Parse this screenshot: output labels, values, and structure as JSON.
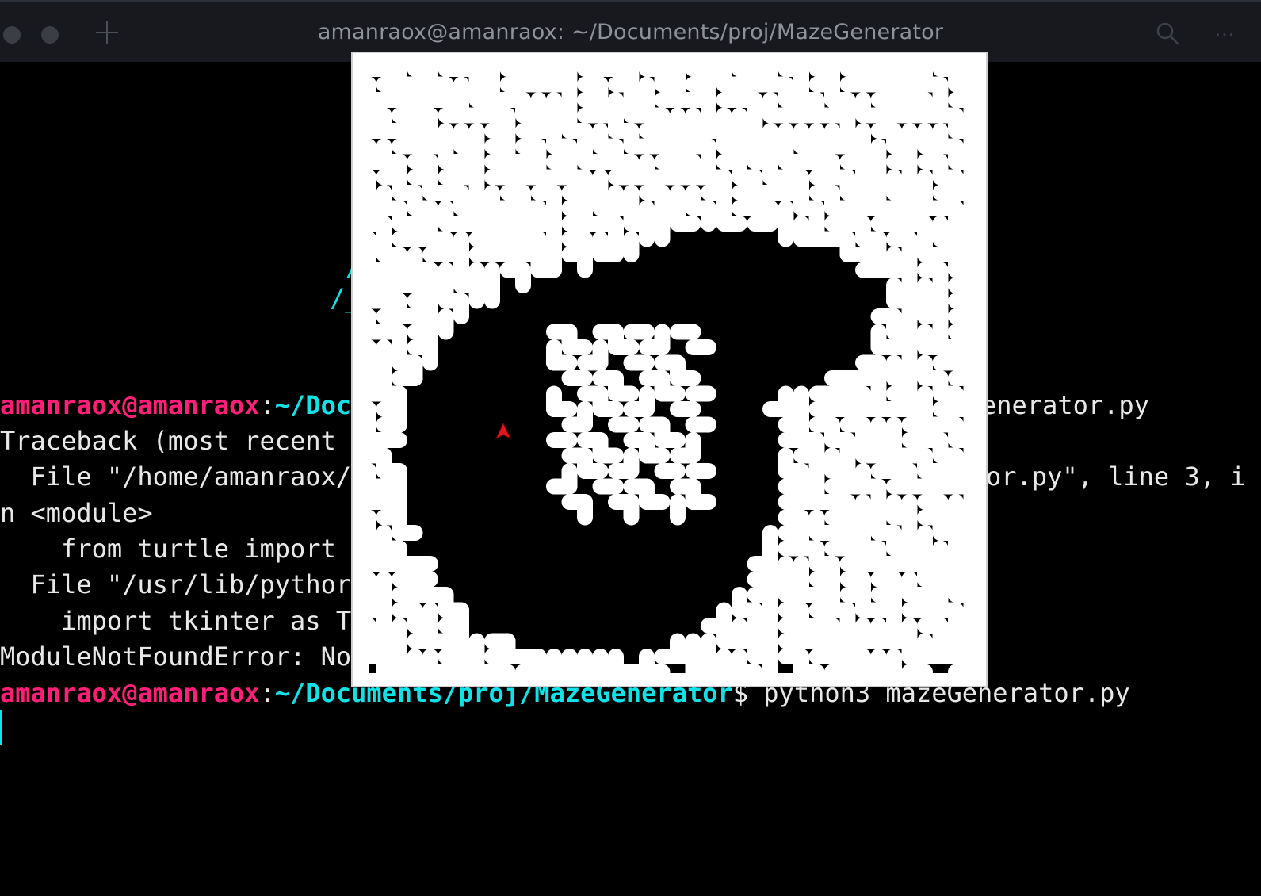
{
  "window": {
    "title": "amanraox@amanraox: ~/Documents/proj/MazeGenerator",
    "menu_glyph": "⋯"
  },
  "terminal": {
    "prompt1": {
      "user": "amanraox@amanraox",
      "sep": ":",
      "path": "~/Doc",
      "tail": "enerator.py"
    },
    "traceback": {
      "line1": "Traceback (most recent",
      "line2": "  File \"/home/amanraox/",
      "line2_tail": "or.py\", line 3, i",
      "line3": "n <module>",
      "line4": "    from turtle import",
      "line5": "  File \"/usr/lib/pythor",
      "line6": "    import tkinter as T",
      "line7": "ModuleNotFoundError: No"
    },
    "prompt2": {
      "user": "amanraox@amanraox",
      "sep": ":",
      "path": "~/Documents/proj/MazeGenerator",
      "dollar": "$",
      "command": " python3 mazeGenerator.py"
    },
    "frag1": "/",
    "frag2": "/_"
  },
  "colors": {
    "user": "#ff1e7a",
    "path": "#10e2e8",
    "text": "#e8e8e8",
    "background": "#000000",
    "turtle": "#e8141e"
  },
  "icons": [
    "close-dot-icon",
    "minimize-dot-icon",
    "plus-icon",
    "search-icon",
    "more-icon",
    "turtle-arrow-icon"
  ]
}
